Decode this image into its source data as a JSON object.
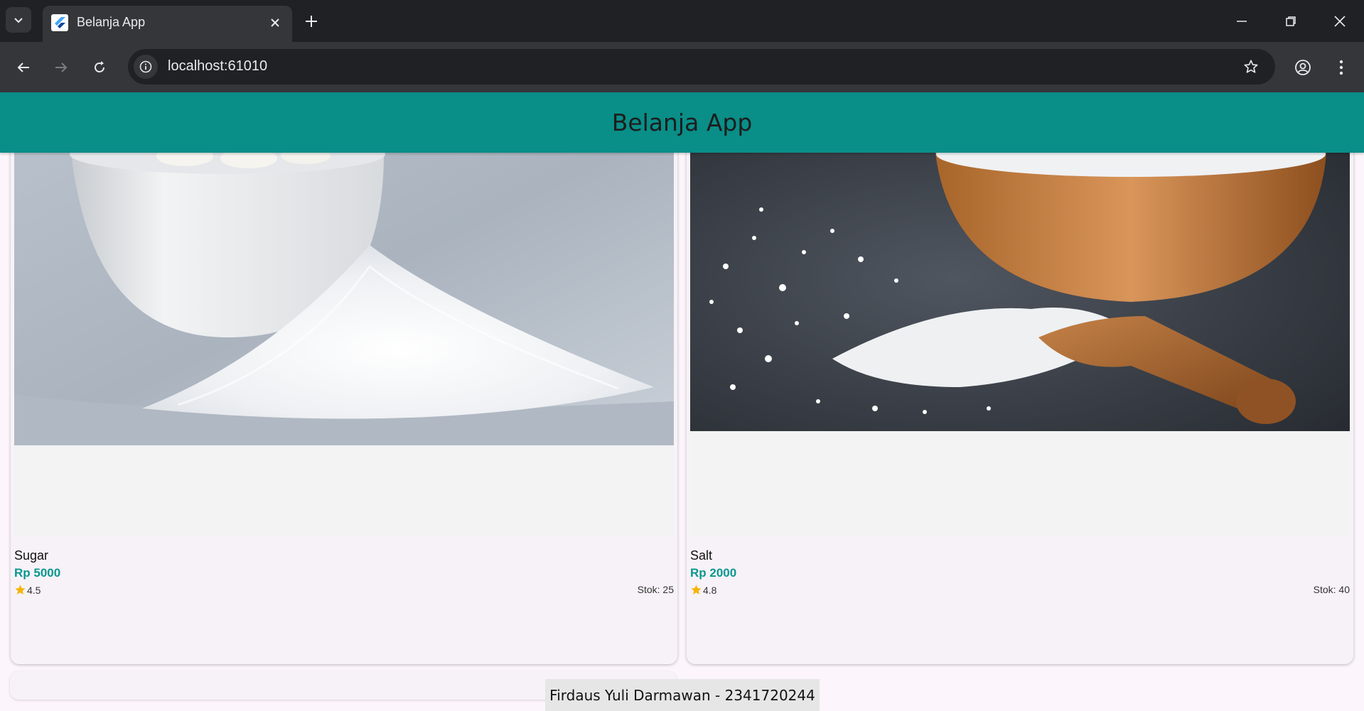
{
  "browser": {
    "tab_title": "Belanja App",
    "url": "localhost:61010"
  },
  "app": {
    "title": "Belanja App",
    "footer": "Firdaus Yuli Darmawan - 2341720244"
  },
  "products": [
    {
      "name": "Sugar",
      "price": "Rp 5000",
      "rating": "4.5",
      "stock": "Stok: 25"
    },
    {
      "name": "Salt",
      "price": "Rp 2000",
      "rating": "4.8",
      "stock": "Stok: 40"
    }
  ],
  "colors": {
    "appbar": "#098e88",
    "price": "#0a978f",
    "star": "#f5b400"
  },
  "icons": [
    "tab-search-icon",
    "flutter-favicon-icon",
    "close-icon",
    "plus-icon",
    "minimize-icon",
    "restore-icon",
    "window-close-icon",
    "back-icon",
    "forward-icon",
    "reload-icon",
    "info-icon",
    "star-outline-icon",
    "profile-icon",
    "more-icon",
    "star-icon"
  ]
}
